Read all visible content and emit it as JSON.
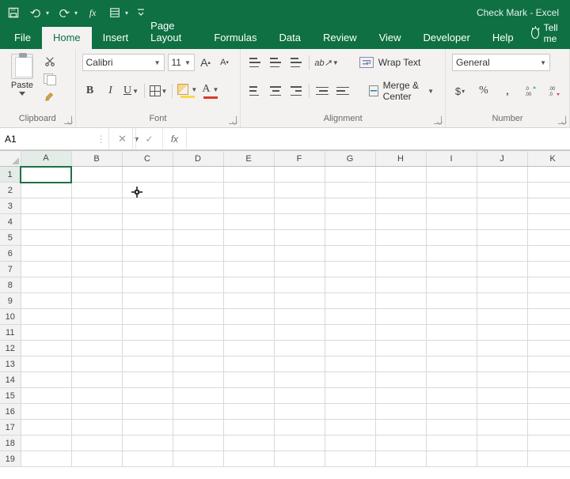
{
  "app": {
    "title": "Check Mark  -  Excel"
  },
  "tabs": {
    "file": "File",
    "home": "Home",
    "insert": "Insert",
    "pageLayout": "Page Layout",
    "formulas": "Formulas",
    "data": "Data",
    "review": "Review",
    "view": "View",
    "developer": "Developer",
    "help": "Help",
    "tellMe": "Tell me"
  },
  "ribbon": {
    "clipboard": {
      "paste": "Paste",
      "label": "Clipboard"
    },
    "font": {
      "name": "Calibri",
      "size": "11",
      "bold": "B",
      "italic": "I",
      "underline": "U",
      "fontColorLetter": "A",
      "growLetter": "A",
      "shrinkLetter": "A",
      "label": "Font"
    },
    "alignment": {
      "wrap": "Wrap Text",
      "merge": "Merge & Center",
      "label": "Alignment"
    },
    "number": {
      "format": "General",
      "currency": "$",
      "percent": "%",
      "comma": ",",
      "incDec": ".0→.00",
      "label": "Number"
    }
  },
  "formulaBar": {
    "nameBox": "A1",
    "fx": "fx",
    "cancel": "✕",
    "enter": "✓",
    "value": ""
  },
  "grid": {
    "columns": [
      "A",
      "B",
      "C",
      "D",
      "E",
      "F",
      "G",
      "H",
      "I",
      "J",
      "K"
    ],
    "rows": [
      "1",
      "2",
      "3",
      "4",
      "5",
      "6",
      "7",
      "8",
      "9",
      "10",
      "11",
      "12",
      "13",
      "14",
      "15",
      "16",
      "17",
      "18",
      "19"
    ],
    "selected": "A1"
  }
}
